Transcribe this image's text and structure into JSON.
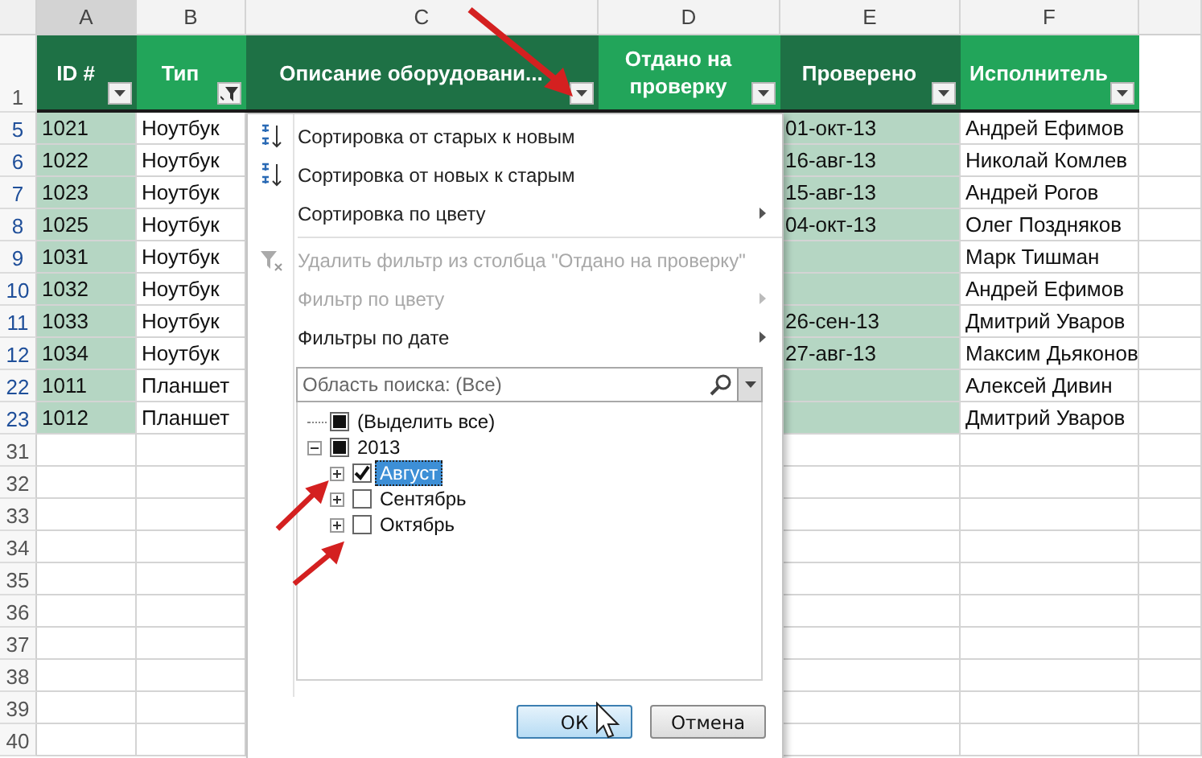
{
  "columns": [
    "A",
    "B",
    "C",
    "D",
    "E",
    "F",
    ""
  ],
  "header_row": {
    "num": "1",
    "cells": [
      {
        "text": "ID #",
        "dark": true,
        "filter_applied": false
      },
      {
        "text": "Тип",
        "dark": false,
        "filter_applied": true
      },
      {
        "text": "Описание оборудовани...",
        "dark": true,
        "filter_applied": false
      },
      {
        "text": "Отдано на проверку",
        "dark": false,
        "filter_applied": false
      },
      {
        "text": "Проверено",
        "dark": true,
        "filter_applied": false
      },
      {
        "text": "Исполнитель",
        "dark": false,
        "filter_applied": false
      }
    ]
  },
  "rows": [
    {
      "num": "5",
      "filtered": true,
      "id": "1021",
      "type": "Ноутбук",
      "checked": "01-окт-13",
      "executor": "Андрей Ефимов"
    },
    {
      "num": "6",
      "filtered": true,
      "id": "1022",
      "type": "Ноутбук",
      "checked": "16-авг-13",
      "executor": "Николай Комлев"
    },
    {
      "num": "7",
      "filtered": true,
      "id": "1023",
      "type": "Ноутбук",
      "checked": "15-авг-13",
      "executor": "Андрей Рогов"
    },
    {
      "num": "8",
      "filtered": true,
      "id": "1025",
      "type": "Ноутбук",
      "checked": "04-окт-13",
      "executor": "Олег Поздняков"
    },
    {
      "num": "9",
      "filtered": true,
      "id": "1031",
      "type": "Ноутбук",
      "executor": "Марк Тишман"
    },
    {
      "num": "10",
      "filtered": true,
      "id": "1032",
      "type": "Ноутбук",
      "executor": "Андрей Ефимов"
    },
    {
      "num": "11",
      "filtered": true,
      "id": "1033",
      "type": "Ноутбук",
      "checked": "26-сен-13",
      "executor": "Дмитрий Уваров"
    },
    {
      "num": "12",
      "filtered": true,
      "id": "1034",
      "type": "Ноутбук",
      "checked": "27-авг-13",
      "executor": "Максим Дьяконов"
    },
    {
      "num": "22",
      "filtered": true,
      "id": "1011",
      "type": "Планшет",
      "executor": "Алексей Дивин"
    },
    {
      "num": "23",
      "filtered": true,
      "id": "1012",
      "type": "Планшет",
      "executor": "Дмитрий Уваров"
    },
    {
      "num": "31",
      "filtered": false
    },
    {
      "num": "32",
      "filtered": false
    },
    {
      "num": "33",
      "filtered": false
    },
    {
      "num": "34",
      "filtered": false
    },
    {
      "num": "35",
      "filtered": false
    },
    {
      "num": "36",
      "filtered": false
    },
    {
      "num": "37",
      "filtered": false
    },
    {
      "num": "38",
      "filtered": false
    },
    {
      "num": "39",
      "filtered": false
    },
    {
      "num": "40",
      "filtered": false
    }
  ],
  "filter_menu": {
    "items": [
      {
        "kind": "sort-asc",
        "label": "Сортировка от старых к новым",
        "disabled": false,
        "submenu": false
      },
      {
        "kind": "sort-desc",
        "label": "Сортировка от новых к старым",
        "disabled": false,
        "submenu": false
      },
      {
        "kind": "plain",
        "label": "Сортировка по цвету",
        "disabled": false,
        "submenu": true
      },
      {
        "kind": "clear-filter",
        "label": "Удалить фильтр из столбца \"Отдано на проверку\"",
        "disabled": true,
        "submenu": false
      },
      {
        "kind": "plain",
        "label": "Фильтр по цвету",
        "disabled": true,
        "submenu": true
      },
      {
        "kind": "plain",
        "label": "Фильтры по дате",
        "disabled": false,
        "submenu": true
      }
    ],
    "search_scope": "Область поиска: (Все)",
    "tree": [
      {
        "label": "(Выделить все)",
        "mixed": true,
        "selected": false
      },
      {
        "label": "2013",
        "mixed": true,
        "selected": false,
        "expanded": true,
        "children": [
          {
            "label": "Август",
            "checked": true,
            "selected": true,
            "expanded": false
          },
          {
            "label": "Сентябрь",
            "checked": false,
            "selected": false,
            "expanded": false
          },
          {
            "label": "Октябрь",
            "checked": false,
            "selected": false,
            "expanded": false
          }
        ]
      }
    ],
    "buttons": [
      {
        "label": "ОК",
        "default": true
      },
      {
        "label": "Отмена",
        "default": false
      }
    ]
  }
}
